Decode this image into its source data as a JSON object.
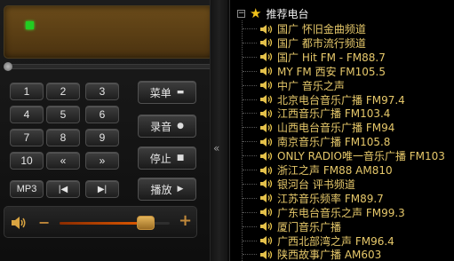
{
  "keypad": {
    "keys": [
      "1",
      "2",
      "3",
      "4",
      "5",
      "6",
      "7",
      "8",
      "9",
      "10",
      "«",
      "»",
      "MP3",
      "|◀",
      "▶|"
    ]
  },
  "controls": {
    "menu": {
      "label": "菜单",
      "glyph": "▬"
    },
    "record": {
      "label": "录音",
      "glyph": "●"
    },
    "stop": {
      "label": "停止",
      "glyph": "■"
    },
    "play": {
      "label": "播放",
      "glyph": "▶"
    }
  },
  "volume": {
    "minus": "−",
    "plus": "+",
    "level": 0.78
  },
  "collapse": {
    "glyph": "«"
  },
  "tree": {
    "expander": "−",
    "root_label": "推荐电台",
    "items": [
      "国广 怀旧金曲频道",
      "国广 都市流行频道",
      "国广 Hit FM - FM88.7",
      "MY FM 西安 FM105.5",
      "中广 音乐之声",
      "北京电台音乐广播 FM97.4",
      "江西音乐广播 FM103.4",
      "山西电台音乐广播 FM94",
      "南京音乐广播 FM105.8",
      "ONLY RADIO唯一音乐广播 FM103",
      "浙江之声 FM88 AM810",
      "银河台 评书频道",
      "江苏音乐频率 FM89.7",
      "广东电台音乐之声 FM99.3",
      "厦门音乐广播",
      "广西北部湾之声 FM96.4",
      "陕西故事广播 AM603"
    ]
  },
  "colors": {
    "accent": "#c0883a",
    "tree_text": "#e6c86a",
    "led": "#22cc22"
  }
}
